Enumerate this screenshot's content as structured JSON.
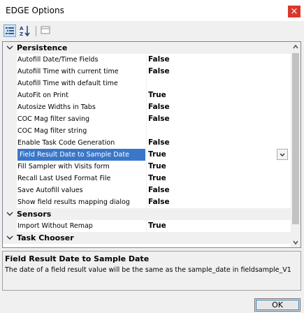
{
  "window": {
    "title": "EDGE Options",
    "close_glyph": "×"
  },
  "toolbar": {
    "buttons": [
      {
        "icon": "categorized-icon"
      },
      {
        "icon": "alphabetical-sort-icon"
      },
      {
        "icon": "property-pages-icon"
      }
    ]
  },
  "grid": {
    "rows": [
      {
        "kind": "category",
        "name": "Persistence",
        "expanded": true
      },
      {
        "kind": "property",
        "name": "Autofill Date/Time Fields",
        "value": "False"
      },
      {
        "kind": "property",
        "name": "Autofill Time with current time",
        "value": "False"
      },
      {
        "kind": "property",
        "name": "Autofill Time with default time",
        "value": ""
      },
      {
        "kind": "property",
        "name": "AutoFit on Print",
        "value": "True"
      },
      {
        "kind": "property",
        "name": "Autosize Widths in Tabs",
        "value": "False"
      },
      {
        "kind": "property",
        "name": "COC Mag filter saving",
        "value": "False"
      },
      {
        "kind": "property",
        "name": "COC Mag filter string",
        "value": ""
      },
      {
        "kind": "property",
        "name": "Enable Task Code Generation",
        "value": "False"
      },
      {
        "kind": "property",
        "name": "Field Result Date to Sample Date",
        "value": "True",
        "selected": true
      },
      {
        "kind": "property",
        "name": "Fill Sampler with Visits form",
        "value": "True"
      },
      {
        "kind": "property",
        "name": "Recall Last Used Format File",
        "value": "True"
      },
      {
        "kind": "property",
        "name": "Save Autofill values",
        "value": "False"
      },
      {
        "kind": "property",
        "name": "Show field results mapping dialog",
        "value": "False"
      },
      {
        "kind": "category",
        "name": "Sensors",
        "expanded": true
      },
      {
        "kind": "property",
        "name": "Import Without Remap",
        "value": "True"
      },
      {
        "kind": "category",
        "name": "Task Chooser",
        "expanded": true
      }
    ]
  },
  "description": {
    "title": "Field Result Date to Sample Date",
    "text": "The date of a field result value will be the same as the sample_date in fieldsample_V1"
  },
  "buttons": {
    "ok_label": "OK"
  },
  "colors": {
    "selection": "#3a77c9",
    "close": "#d9372b",
    "category_bg": "#f0f0f0"
  }
}
